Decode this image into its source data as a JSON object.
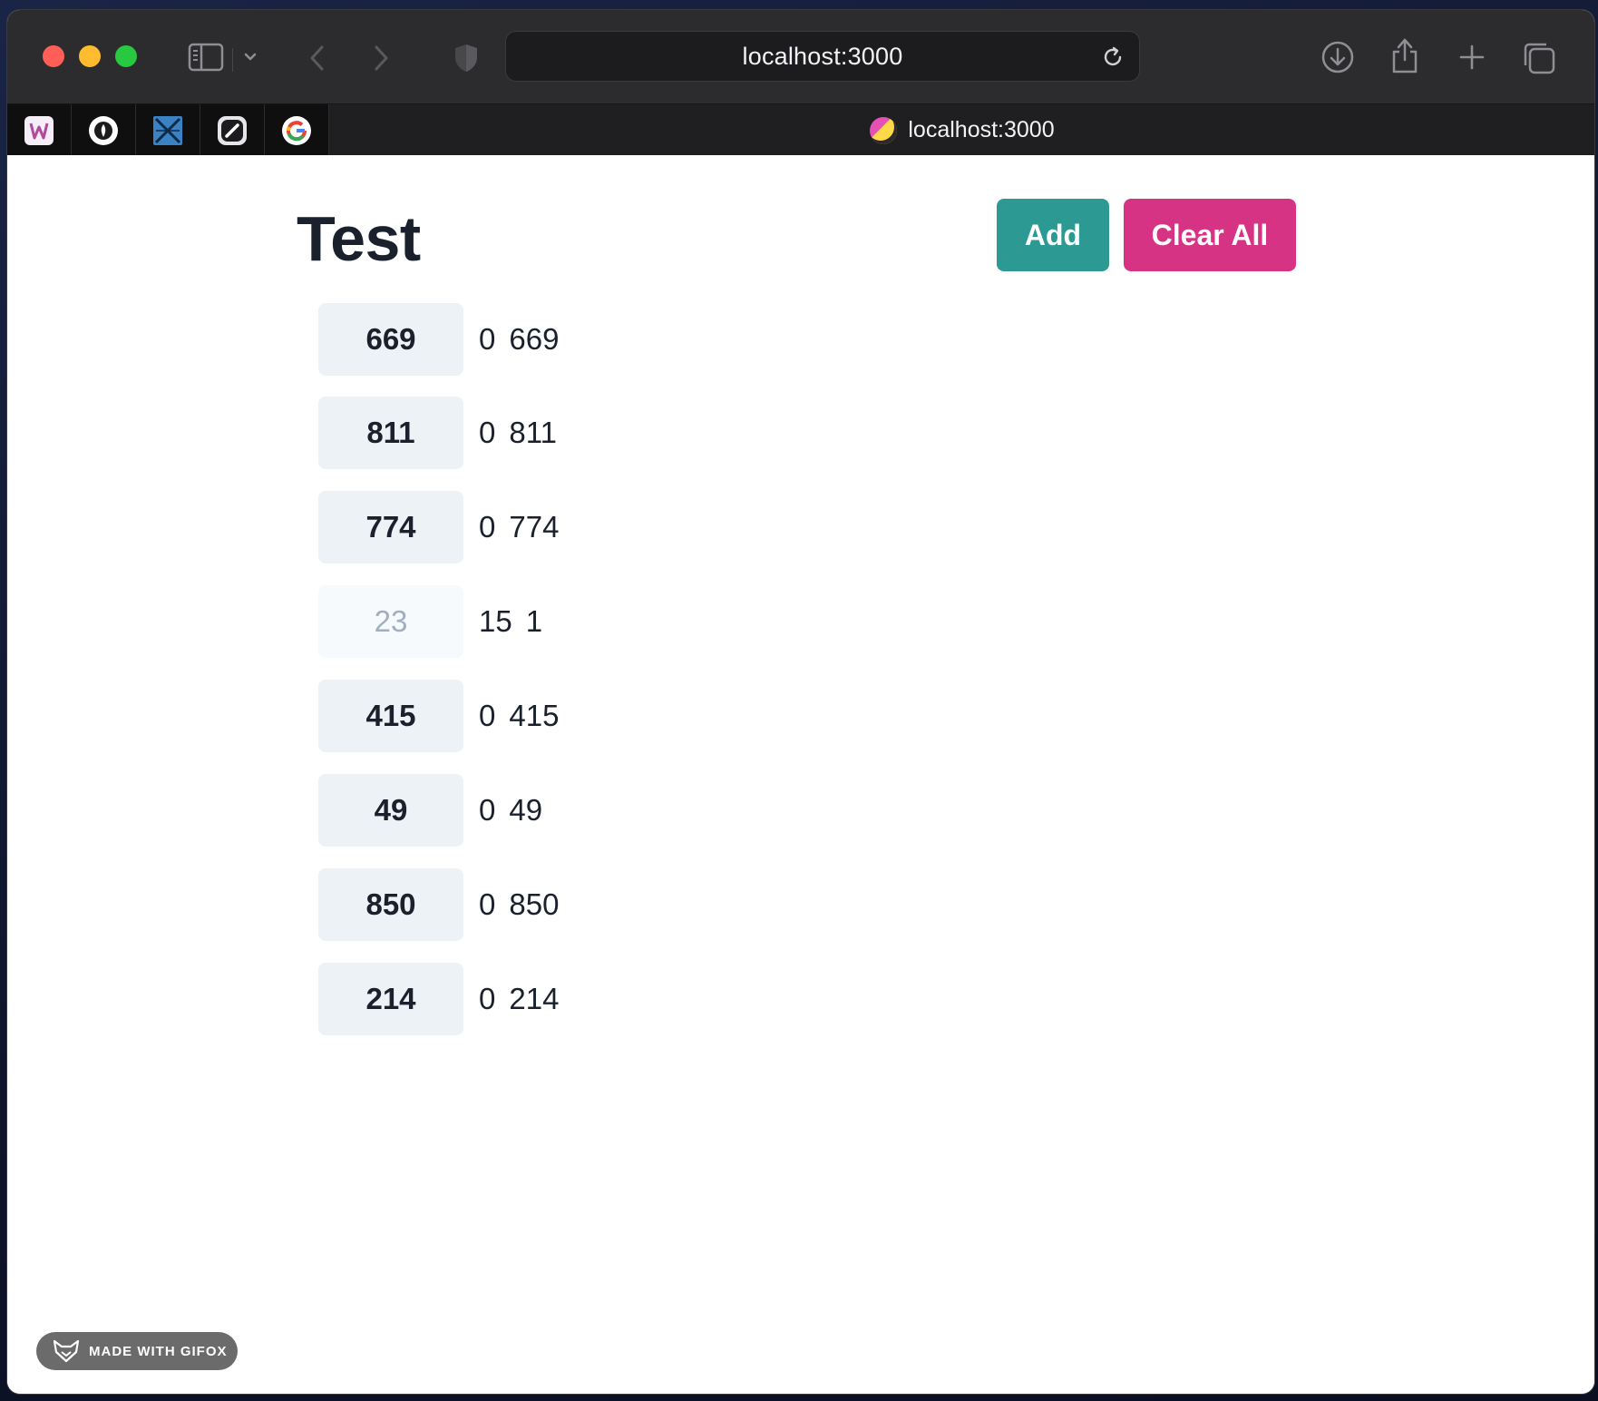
{
  "browser": {
    "address_text": "localhost:3000",
    "tab_title": "localhost:3000",
    "favorites": [
      {
        "name": "favorite-1",
        "icon": "wavy-logo-icon"
      },
      {
        "name": "favorite-2",
        "icon": "pen-nib-icon"
      },
      {
        "name": "favorite-3",
        "icon": "blue-cross-icon"
      },
      {
        "name": "favorite-4",
        "icon": "slash-logo-icon"
      },
      {
        "name": "favorite-5",
        "icon": "google-g-icon"
      }
    ]
  },
  "page": {
    "title": "Test",
    "add_label": "Add",
    "clear_label": "Clear All",
    "colors": {
      "add": "#2c9a93",
      "clear": "#d63384",
      "chip": "#edf2f7",
      "text": "#1a202c"
    },
    "items": [
      {
        "chip": "669",
        "a": "0",
        "b": "669",
        "faded": false
      },
      {
        "chip": "811",
        "a": "0",
        "b": "811",
        "faded": false
      },
      {
        "chip": "774",
        "a": "0",
        "b": "774",
        "faded": false
      },
      {
        "chip": "23",
        "a": "15",
        "b": "1",
        "faded": true
      },
      {
        "chip": "415",
        "a": "0",
        "b": "415",
        "faded": false
      },
      {
        "chip": "49",
        "a": "0",
        "b": "49",
        "faded": false
      },
      {
        "chip": "850",
        "a": "0",
        "b": "850",
        "faded": false
      },
      {
        "chip": "214",
        "a": "0",
        "b": "214",
        "faded": false
      }
    ]
  },
  "watermark": {
    "label": "MADE WITH GIFOX"
  }
}
